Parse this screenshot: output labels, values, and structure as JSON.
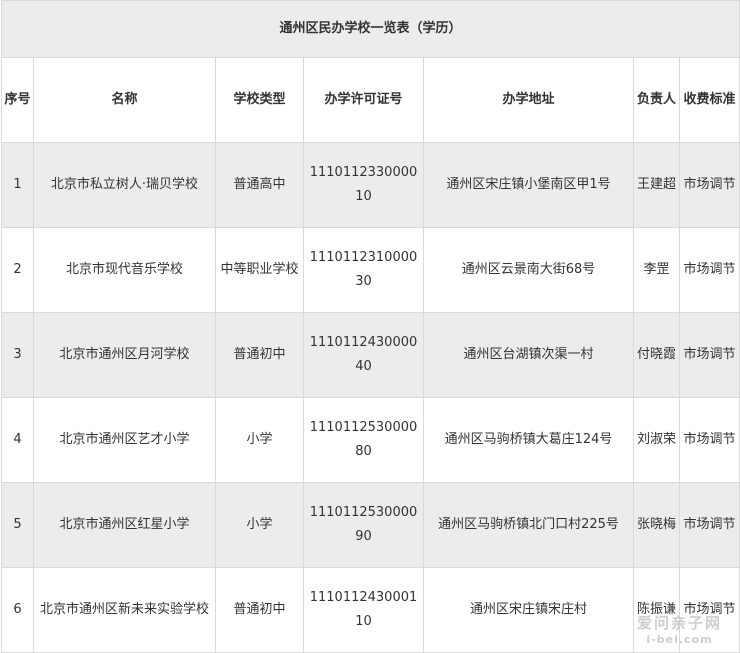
{
  "table": {
    "title": "通州区民办学校一览表（学历）",
    "headers": [
      "序号",
      "名称",
      "学校类型",
      "办学许可证号",
      "办学地址",
      "负责人",
      "收费标准"
    ],
    "rows": [
      [
        "1",
        "北京市私立树人·瑞贝学校",
        "普通高中",
        "111011233000010",
        "通州区宋庄镇小堡南区甲1号",
        "王建超",
        "市场调节"
      ],
      [
        "2",
        "北京市现代音乐学校",
        "中等职业学校",
        "111011231000030",
        "通州区云景南大街68号",
        "李罡",
        "市场调节"
      ],
      [
        "3",
        "北京市通州区月河学校",
        "普通初中",
        "111011243000040",
        "通州区台湖镇次渠一村",
        "付晓霞",
        "市场调节"
      ],
      [
        "4",
        "北京市通州区艺才小学",
        "小学",
        "111011253000080",
        "通州区马驹桥镇大葛庄124号",
        "刘淑荣",
        "市场调节"
      ],
      [
        "5",
        "北京市通州区红星小学",
        "小学",
        "111011253000090",
        "通州区马驹桥镇北门口村225号",
        "张晓梅",
        "市场调节"
      ],
      [
        "6",
        "北京市通州区新未来实验学校",
        "普通初中",
        "111011243000110",
        "通州区宋庄镇宋庄村",
        "陈振谦",
        "市场调节"
      ]
    ]
  },
  "watermark": {
    "text": "爱问亲子网",
    "url": "i-bei.com"
  }
}
